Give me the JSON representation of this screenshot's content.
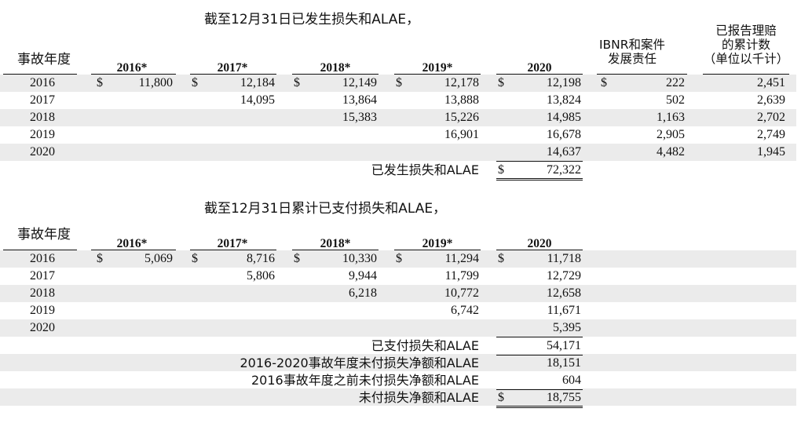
{
  "incurred": {
    "title": "截至12月31日已发生损失和ALAE，",
    "ay_label": "事故年度",
    "ibnr_header": [
      "IBNR和案件",
      "发展责任"
    ],
    "claims_header": [
      "已报告理赔",
      "的累计数",
      "（单位以千计）"
    ],
    "year_headers": [
      "2016*",
      "2017*",
      "2018*",
      "2019*",
      "2020"
    ],
    "rows": [
      {
        "ay": "2016",
        "values": [
          "11,800",
          "12,184",
          "12,149",
          "12,178",
          "12,198"
        ],
        "ibnr": "222",
        "claims": "2,451"
      },
      {
        "ay": "2017",
        "values": [
          "",
          "14,095",
          "13,864",
          "13,888",
          "13,824"
        ],
        "ibnr": "502",
        "claims": "2,639"
      },
      {
        "ay": "2018",
        "values": [
          "",
          "",
          "15,383",
          "15,226",
          "14,985"
        ],
        "ibnr": "1,163",
        "claims": "2,702"
      },
      {
        "ay": "2019",
        "values": [
          "",
          "",
          "",
          "16,901",
          "16,678"
        ],
        "ibnr": "2,905",
        "claims": "2,749"
      },
      {
        "ay": "2020",
        "values": [
          "",
          "",
          "",
          "",
          "14,637"
        ],
        "ibnr": "4,482",
        "claims": "1,945"
      }
    ],
    "dollar": "$",
    "total_label": "已发生损失和ALAE",
    "total_value": "72,322"
  },
  "paid": {
    "title": "截至12月31日累计已支付损失和ALAE，",
    "ay_label": "事故年度",
    "year_headers": [
      "2016*",
      "2017*",
      "2018*",
      "2019*",
      "2020"
    ],
    "rows": [
      {
        "ay": "2016",
        "values": [
          "5,069",
          "8,716",
          "10,330",
          "11,294",
          "11,718"
        ]
      },
      {
        "ay": "2017",
        "values": [
          "",
          "5,806",
          "9,944",
          "11,799",
          "12,729"
        ]
      },
      {
        "ay": "2018",
        "values": [
          "",
          "",
          "6,218",
          "10,772",
          "12,658"
        ]
      },
      {
        "ay": "2019",
        "values": [
          "",
          "",
          "",
          "6,742",
          "11,671"
        ]
      },
      {
        "ay": "2020",
        "values": [
          "",
          "",
          "",
          "",
          "5,395"
        ]
      }
    ],
    "dollar": "$",
    "summary": [
      {
        "label": "已支付损失和ALAE",
        "value": "54,171"
      },
      {
        "label": "2016-2020事故年度未付损失净额和ALAE",
        "value": "18,151"
      },
      {
        "label": "2016事故年度之前未付损失净额和ALAE",
        "value": "604"
      },
      {
        "label": "未付损失净额和ALAE",
        "value": "18,755"
      }
    ]
  }
}
